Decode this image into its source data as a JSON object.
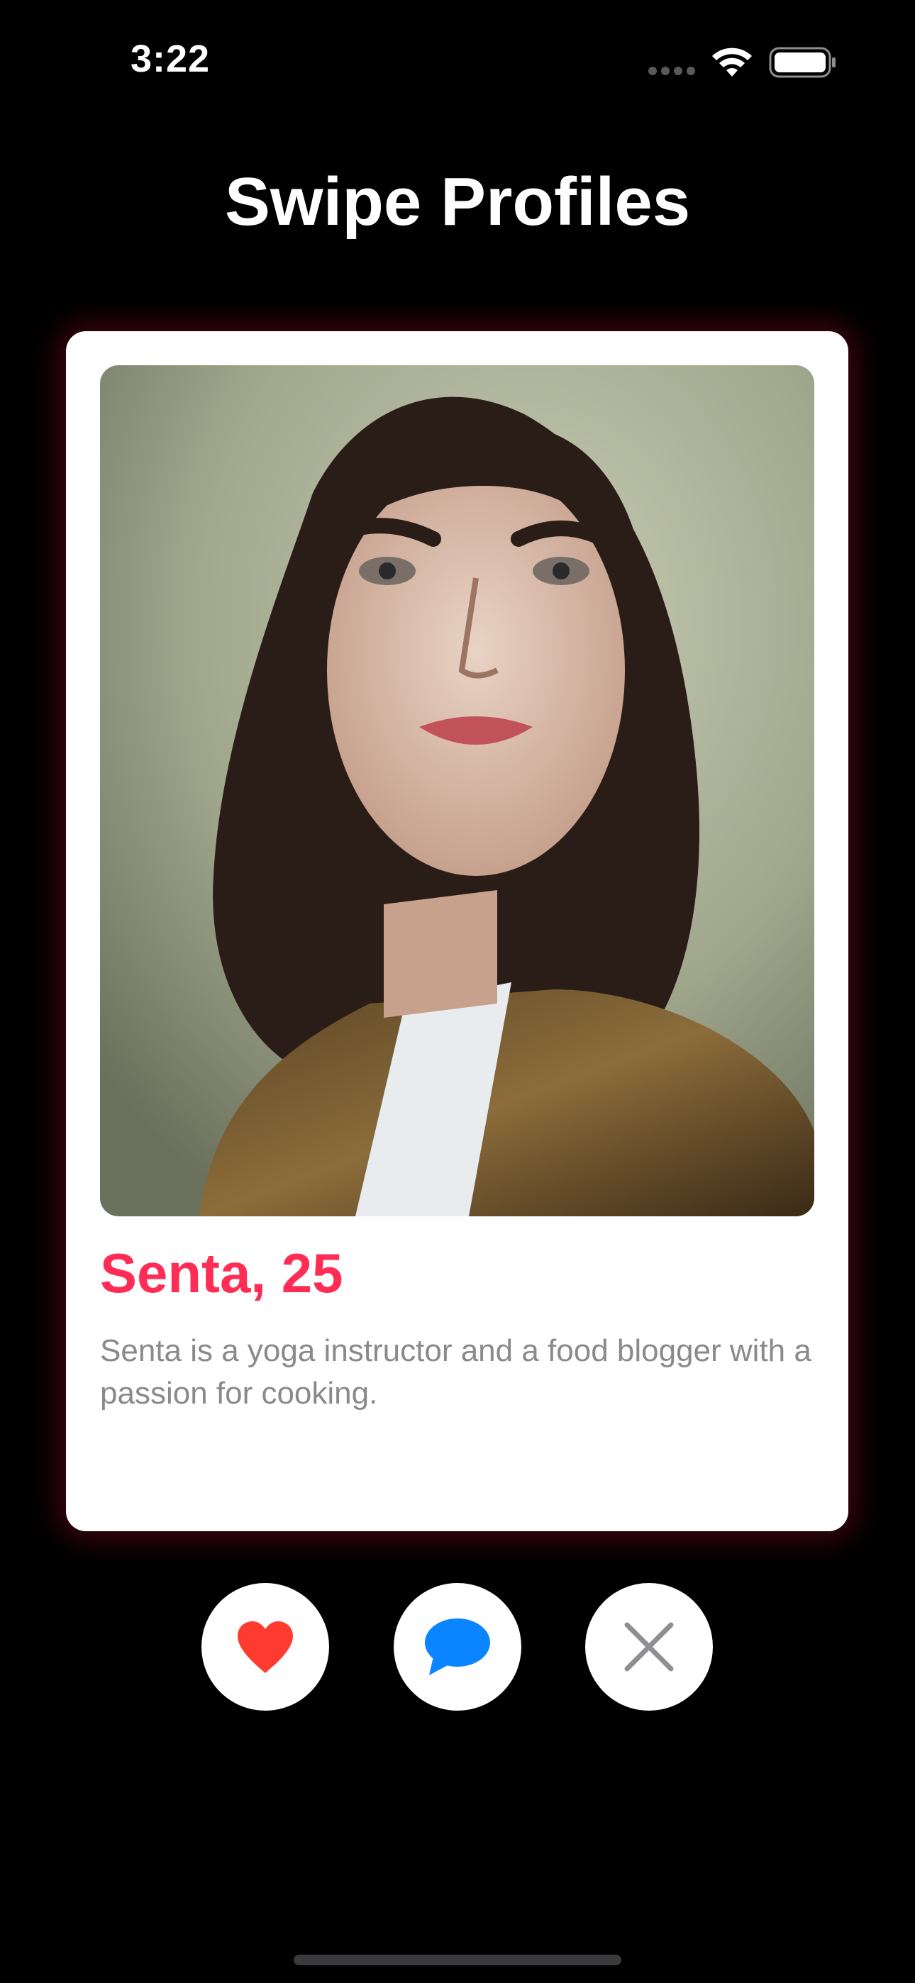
{
  "status_bar": {
    "time": "3:22",
    "icons": [
      "cellular-signal-icon",
      "wifi-icon",
      "battery-icon"
    ]
  },
  "header": {
    "title": "Swipe Profiles"
  },
  "profile": {
    "name_age": "Senta, 25",
    "bio": "Senta is a yoga instructor and a food blogger with a passion for cooking."
  },
  "actions": [
    {
      "icon": "heart-icon",
      "color": "#FF3B30"
    },
    {
      "icon": "message-bubble-icon",
      "color": "#0A84FF"
    },
    {
      "icon": "close-icon",
      "color": "#8E8E93"
    }
  ],
  "colors": {
    "background": "#000000",
    "card": "#FFFFFF",
    "accent_name": "#FF2D55",
    "bio_text": "#8A8A8E"
  }
}
